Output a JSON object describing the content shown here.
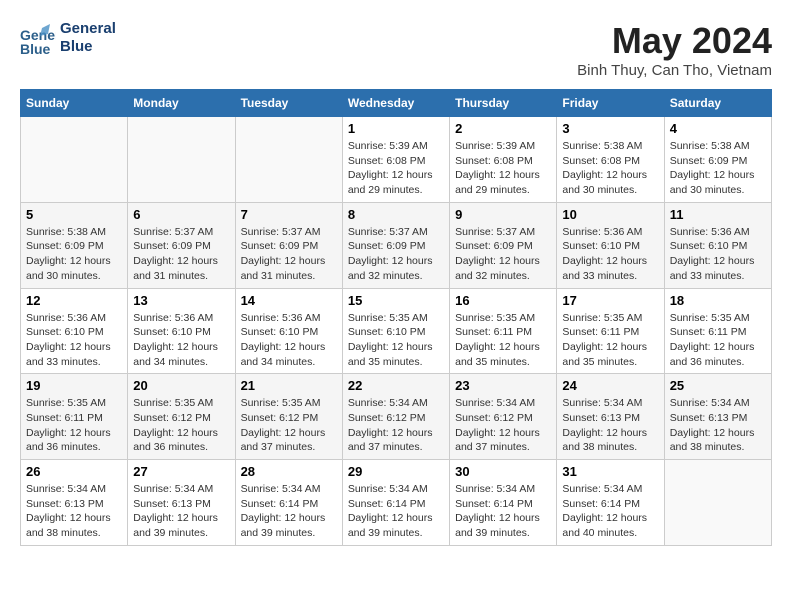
{
  "header": {
    "logo_line1": "General",
    "logo_line2": "Blue",
    "month_title": "May 2024",
    "subtitle": "Binh Thuy, Can Tho, Vietnam"
  },
  "days_of_week": [
    "Sunday",
    "Monday",
    "Tuesday",
    "Wednesday",
    "Thursday",
    "Friday",
    "Saturday"
  ],
  "weeks": [
    {
      "cells": [
        {
          "day": "",
          "info": ""
        },
        {
          "day": "",
          "info": ""
        },
        {
          "day": "",
          "info": ""
        },
        {
          "day": "1",
          "info": "Sunrise: 5:39 AM\nSunset: 6:08 PM\nDaylight: 12 hours\nand 29 minutes."
        },
        {
          "day": "2",
          "info": "Sunrise: 5:39 AM\nSunset: 6:08 PM\nDaylight: 12 hours\nand 29 minutes."
        },
        {
          "day": "3",
          "info": "Sunrise: 5:38 AM\nSunset: 6:08 PM\nDaylight: 12 hours\nand 30 minutes."
        },
        {
          "day": "4",
          "info": "Sunrise: 5:38 AM\nSunset: 6:09 PM\nDaylight: 12 hours\nand 30 minutes."
        }
      ]
    },
    {
      "cells": [
        {
          "day": "5",
          "info": "Sunrise: 5:38 AM\nSunset: 6:09 PM\nDaylight: 12 hours\nand 30 minutes."
        },
        {
          "day": "6",
          "info": "Sunrise: 5:37 AM\nSunset: 6:09 PM\nDaylight: 12 hours\nand 31 minutes."
        },
        {
          "day": "7",
          "info": "Sunrise: 5:37 AM\nSunset: 6:09 PM\nDaylight: 12 hours\nand 31 minutes."
        },
        {
          "day": "8",
          "info": "Sunrise: 5:37 AM\nSunset: 6:09 PM\nDaylight: 12 hours\nand 32 minutes."
        },
        {
          "day": "9",
          "info": "Sunrise: 5:37 AM\nSunset: 6:09 PM\nDaylight: 12 hours\nand 32 minutes."
        },
        {
          "day": "10",
          "info": "Sunrise: 5:36 AM\nSunset: 6:10 PM\nDaylight: 12 hours\nand 33 minutes."
        },
        {
          "day": "11",
          "info": "Sunrise: 5:36 AM\nSunset: 6:10 PM\nDaylight: 12 hours\nand 33 minutes."
        }
      ]
    },
    {
      "cells": [
        {
          "day": "12",
          "info": "Sunrise: 5:36 AM\nSunset: 6:10 PM\nDaylight: 12 hours\nand 33 minutes."
        },
        {
          "day": "13",
          "info": "Sunrise: 5:36 AM\nSunset: 6:10 PM\nDaylight: 12 hours\nand 34 minutes."
        },
        {
          "day": "14",
          "info": "Sunrise: 5:36 AM\nSunset: 6:10 PM\nDaylight: 12 hours\nand 34 minutes."
        },
        {
          "day": "15",
          "info": "Sunrise: 5:35 AM\nSunset: 6:10 PM\nDaylight: 12 hours\nand 35 minutes."
        },
        {
          "day": "16",
          "info": "Sunrise: 5:35 AM\nSunset: 6:11 PM\nDaylight: 12 hours\nand 35 minutes."
        },
        {
          "day": "17",
          "info": "Sunrise: 5:35 AM\nSunset: 6:11 PM\nDaylight: 12 hours\nand 35 minutes."
        },
        {
          "day": "18",
          "info": "Sunrise: 5:35 AM\nSunset: 6:11 PM\nDaylight: 12 hours\nand 36 minutes."
        }
      ]
    },
    {
      "cells": [
        {
          "day": "19",
          "info": "Sunrise: 5:35 AM\nSunset: 6:11 PM\nDaylight: 12 hours\nand 36 minutes."
        },
        {
          "day": "20",
          "info": "Sunrise: 5:35 AM\nSunset: 6:12 PM\nDaylight: 12 hours\nand 36 minutes."
        },
        {
          "day": "21",
          "info": "Sunrise: 5:35 AM\nSunset: 6:12 PM\nDaylight: 12 hours\nand 37 minutes."
        },
        {
          "day": "22",
          "info": "Sunrise: 5:34 AM\nSunset: 6:12 PM\nDaylight: 12 hours\nand 37 minutes."
        },
        {
          "day": "23",
          "info": "Sunrise: 5:34 AM\nSunset: 6:12 PM\nDaylight: 12 hours\nand 37 minutes."
        },
        {
          "day": "24",
          "info": "Sunrise: 5:34 AM\nSunset: 6:13 PM\nDaylight: 12 hours\nand 38 minutes."
        },
        {
          "day": "25",
          "info": "Sunrise: 5:34 AM\nSunset: 6:13 PM\nDaylight: 12 hours\nand 38 minutes."
        }
      ]
    },
    {
      "cells": [
        {
          "day": "26",
          "info": "Sunrise: 5:34 AM\nSunset: 6:13 PM\nDaylight: 12 hours\nand 38 minutes."
        },
        {
          "day": "27",
          "info": "Sunrise: 5:34 AM\nSunset: 6:13 PM\nDaylight: 12 hours\nand 39 minutes."
        },
        {
          "day": "28",
          "info": "Sunrise: 5:34 AM\nSunset: 6:14 PM\nDaylight: 12 hours\nand 39 minutes."
        },
        {
          "day": "29",
          "info": "Sunrise: 5:34 AM\nSunset: 6:14 PM\nDaylight: 12 hours\nand 39 minutes."
        },
        {
          "day": "30",
          "info": "Sunrise: 5:34 AM\nSunset: 6:14 PM\nDaylight: 12 hours\nand 39 minutes."
        },
        {
          "day": "31",
          "info": "Sunrise: 5:34 AM\nSunset: 6:14 PM\nDaylight: 12 hours\nand 40 minutes."
        },
        {
          "day": "",
          "info": ""
        }
      ]
    }
  ]
}
